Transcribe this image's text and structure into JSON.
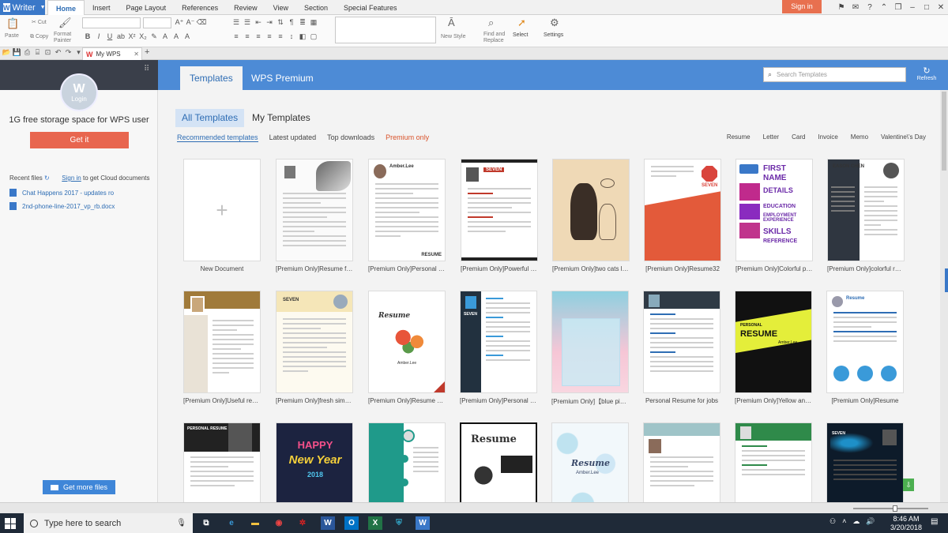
{
  "app": {
    "name": "Writer",
    "tabs": [
      "Home",
      "Insert",
      "Page Layout",
      "References",
      "Review",
      "View",
      "Section",
      "Special Features"
    ],
    "active_tab": "Home",
    "sign_in": "Sign in"
  },
  "ribbon": {
    "paste": "Paste",
    "cut": "Cut",
    "copy": "Copy",
    "format_painter": "Format Painter",
    "new_style": "New Style",
    "find_replace": "Find and Replace",
    "select": "Select",
    "settings": "Settings"
  },
  "doc_tab": {
    "label": "My WPS"
  },
  "sidebar": {
    "login_label": "Login",
    "storage_text": "1G free storage space for WPS user",
    "get_it": "Get it",
    "recent_files_label": "Recent files",
    "signin_link": "Sign in",
    "signin_suffix": "to get Cloud documents",
    "files": [
      "Chat Happens 2017 - updates ro",
      "2nd-phone-line-2017_vp_rb.docx"
    ],
    "get_more": "Get more files"
  },
  "main": {
    "tabs": [
      "Templates",
      "WPS Premium"
    ],
    "active_tab": "Templates",
    "search_placeholder": "Search Templates",
    "refresh": "Refresh",
    "subtabs": [
      "All Templates",
      "My Templates"
    ],
    "filters": [
      "Recommended templates",
      "Latest updated",
      "Top downloads",
      "Premium only"
    ],
    "categories": [
      "Resume",
      "Letter",
      "Card",
      "Invoice",
      "Memo",
      "Valentine\\'s Day"
    ],
    "templates_row1": [
      "New Document",
      "[Premium Only]Resume for...",
      "[Premium Only]Personal res...",
      "[Premium Only]Powerful Re...",
      "[Premium Only]two cats let...",
      "[Premium Only]Resume32",
      "[Premium Only]Colorful po...",
      "[Premium Only]colorful resu..."
    ],
    "templates_row2": [
      "[Premium Only]Useful resum",
      "[Premium Only]fresh simple...",
      "[Premium Only]Resume wit...",
      "[Premium Only]Personal Re...",
      "[Premium Only]【blue pink l...",
      "Personal Resume for jobs",
      "[Premium Only]Yellow and ...",
      "[Premium Only]Resume"
    ],
    "thumb_text": {
      "seven": "SEVEN",
      "amber_lee": "Amber.Lee",
      "resume": "Resume",
      "resume_caps": "RESUME",
      "first": "FIRST",
      "name": "NAME",
      "details": "DETAILS",
      "education": "EDUCATION",
      "employment": "EMPLOYMENT EXPERIENCE",
      "skills": "SKILLS",
      "reference": "REFERENCE",
      "eason": "EASON CHEN",
      "personal": "PERSONAL",
      "happy": "HAPPY",
      "new_year": "New Year",
      "year": "2018",
      "personal_resume": "PERSONAL RESUME"
    }
  },
  "taskbar": {
    "search_placeholder": "Type here to search",
    "time": "8:46 AM",
    "date": "3/20/2018"
  },
  "colors": {
    "accent": "#4d8bd6",
    "sign_in": "#e8704f",
    "premium": "#d9532b"
  }
}
